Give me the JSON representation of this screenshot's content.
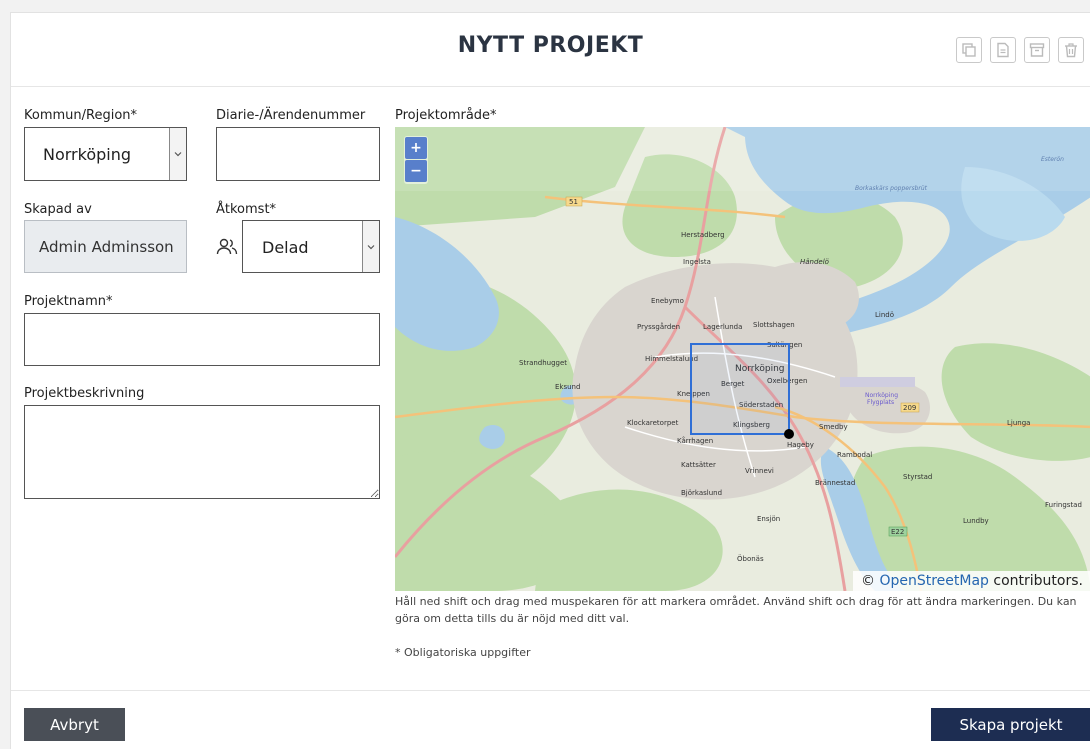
{
  "dialog": {
    "title": "NYTT PROJEKT",
    "header_icons": [
      "copy-icon",
      "document-icon",
      "archive-icon",
      "trash-icon"
    ]
  },
  "form": {
    "municipality": {
      "label": "Kommun/Region*",
      "value": "Norrköping"
    },
    "case_number": {
      "label": "Diarie-/Ärendenummer",
      "value": ""
    },
    "created_by": {
      "label": "Skapad av",
      "value": "Admin Adminsson"
    },
    "access": {
      "label": "Åtkomst*",
      "value": "Delad",
      "icon": "users-icon"
    },
    "project_name": {
      "label": "Projektnamn*",
      "value": ""
    },
    "description": {
      "label": "Projektbeskrivning",
      "value": ""
    }
  },
  "map": {
    "label": "Projektområde*",
    "zoom_in": "+",
    "zoom_out": "−",
    "attribution_prefix": "© ",
    "attribution_link": "OpenStreetMap",
    "attribution_suffix": " contributors.",
    "place_labels": [
      "Herstadberg",
      "Händelö",
      "Ingelsta",
      "Enebymo",
      "Lagerlunda",
      "Slottshagen",
      "Pryssgården",
      "Himmelstalund",
      "Saltängen",
      "Norrköping",
      "Oxelbergen",
      "Berget",
      "Kneippen",
      "Söderstaden",
      "Klockaretorpet",
      "Klingsberg",
      "Hageby",
      "Smedby",
      "Kårrhagen",
      "Rambodal",
      "Kattsätter",
      "Vrinnevi",
      "Brånnestad",
      "Björkaslund",
      "Lindö",
      "Strandhugget",
      "Eksund",
      "Norrköping Flygplats",
      "Ljunga",
      "Styrstad",
      "Lundby",
      "Furingstad",
      "Ensjön",
      "Öbonäs",
      "Borkaskärs poppersbrüt",
      "Esterön"
    ],
    "road_labels": [
      "51",
      "209",
      "E22"
    ],
    "help_text": "Håll ned shift och drag med muspekaren för att markera området. Använd shift och drag för att ändra markeringen. Du kan göra om detta tills du är nöjd med ditt val.",
    "required_note": "* Obligatoriska uppgifter"
  },
  "actions": {
    "cancel_label": "Avbryt",
    "create_label": "Skapa projekt"
  },
  "colors": {
    "primary_button": "#1d2d52",
    "secondary_button": "#4a4f57",
    "selection": "#2f6fd6",
    "water": "#a9cde8",
    "forest": "#b9d9a5"
  }
}
